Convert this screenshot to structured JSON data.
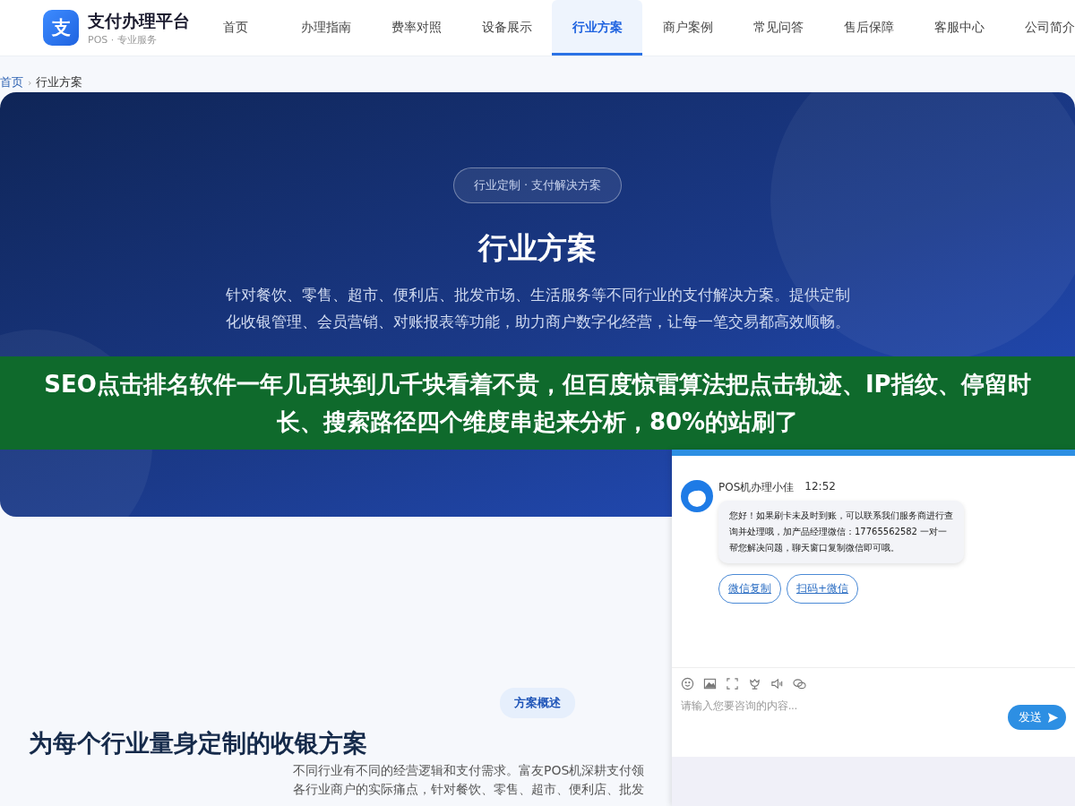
{
  "logo": {
    "mark": "支",
    "title": "支付办理平台",
    "subtitle": "POS · 专业服务"
  },
  "nav": [
    {
      "label": "首页",
      "selected": false
    },
    {
      "label": "办理指南",
      "selected": false
    },
    {
      "label": "费率对照",
      "selected": false
    },
    {
      "label": "设备展示",
      "selected": false
    },
    {
      "label": "行业方案",
      "selected": true
    },
    {
      "label": "商户案例",
      "selected": false
    },
    {
      "label": "常见问答",
      "selected": false
    },
    {
      "label": "售后保障",
      "selected": false
    },
    {
      "label": "客服中心",
      "selected": false
    },
    {
      "label": "公司简介",
      "selected": false
    }
  ],
  "breadcrumb": {
    "separator": "›",
    "items": [
      {
        "label": "首页",
        "kind": "link"
      },
      {
        "label": "行业方案",
        "kind": "current"
      }
    ]
  },
  "hero": {
    "tag": "行业定制 · 支付解决方案",
    "title": "行业方案",
    "description": "针对餐饮、零售、超市、便利店、批发市场、生活服务等不同行业的支付解决方案。提供定制化收银管理、会员营销、对账报表等功能，助力商户数字化经营，让每一笔交易都高效顺畅。"
  },
  "banner": {
    "text": "SEO点击排名软件一年几百块到几千块看着不贵，但百度惊雷算法把点击轨迹、IP指纹、停留时长、搜索路径四个维度串起来分析，80%的站刷了"
  },
  "overview": {
    "tag": "方案概述",
    "heading": "为每个行业量身定制的收银方案",
    "lines": [
      "不同行业有不同的经营逻辑和支付需求。富友POS机深耕支付领",
      "各行业商户的实际痛点，针对餐饮、零售、超市、便利店、批发"
    ]
  },
  "chat": {
    "agent": "POS机办理小佳",
    "time": "12:52",
    "message": "您好！如果刷卡未及时到账，可以联系我们服务商进行查询并处理哦，加产品经理微信：17765562582 一对一帮您解决问题，聊天窗口复制微信即可哦。",
    "actions": [
      "微信复制",
      "扫码+微信"
    ],
    "placeholder": "请输入您要咨询的内容...",
    "send": "发送"
  }
}
